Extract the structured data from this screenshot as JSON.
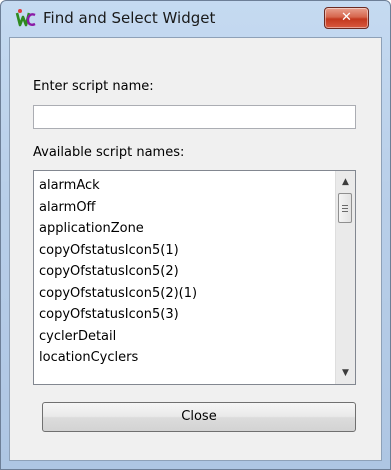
{
  "window": {
    "title": "Find and Select Widget",
    "close_glyph": "✕",
    "app_icon": "wc-app-icon"
  },
  "form": {
    "script_name_label": "Enter script name:",
    "script_name_value": "",
    "script_name_placeholder": "",
    "available_label": "Available script names:"
  },
  "list": {
    "items": [
      "alarmAck",
      "alarmOff",
      "applicationZone",
      "copyOfstatusIcon5(1)",
      "copyOfstatusIcon5(2)",
      "copyOfstatusIcon5(2)(1)",
      "copyOfstatusIcon5(3)",
      "cyclerDetail",
      "locationCyclers"
    ],
    "scroll_up_glyph": "▲",
    "scroll_down_glyph": "▼"
  },
  "buttons": {
    "close_label": "Close"
  }
}
